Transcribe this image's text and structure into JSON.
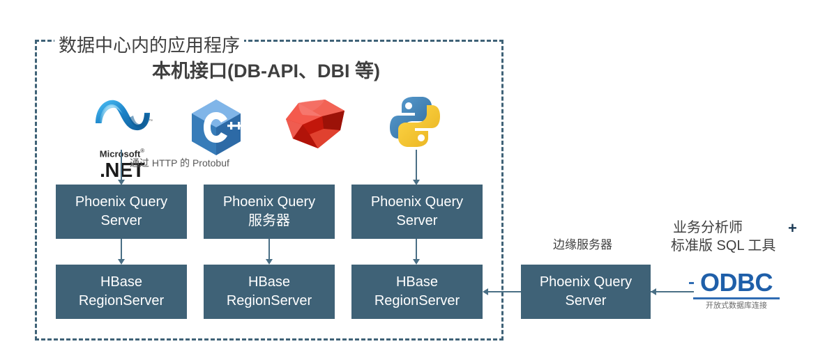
{
  "diagram": {
    "datacenter_title": "数据中心内的应用程序",
    "interface_title": "本机接口(DB-API、DBI 等)",
    "protobuf_label": "通过 HTTP 的 Protobuf",
    "edge_server_label": "边缘服务器",
    "analyst_label": "业务分析师",
    "analyst_plus": "+",
    "tool_label": "标准版 SQL 工具"
  },
  "logos": [
    {
      "name": "dotnet-logo",
      "caption_brand": "Microsoft",
      "caption_reg": "®",
      "caption_name": ".NET"
    },
    {
      "name": "cplusplus-logo",
      "letter": "C",
      "plus": "++"
    },
    {
      "name": "ruby-logo"
    },
    {
      "name": "python-logo"
    }
  ],
  "query_servers": [
    {
      "line1": "Phoenix Query",
      "line2": "Server"
    },
    {
      "line1": "Phoenix Query",
      "line2": "服务器"
    },
    {
      "line1": "Phoenix Query",
      "line2": "Server"
    }
  ],
  "region_servers": [
    {
      "line1": "HBase",
      "line2": "RegionServer"
    },
    {
      "line1": "HBase",
      "line2": "RegionServer"
    },
    {
      "line1": "HBase",
      "line2": "RegionServer"
    }
  ],
  "edge_server": {
    "line1": "Phoenix Query",
    "line2": "Server"
  },
  "odbc": {
    "word": "ODBC",
    "subtitle": "开放式数据库连接"
  },
  "colors": {
    "box_fill": "#3f6277",
    "box_text": "#ffffff",
    "border_dash": "#3f6277",
    "connector": "#4a6f85",
    "odbc_blue": "#1f5fa9",
    "text": "#3f3f3f"
  }
}
